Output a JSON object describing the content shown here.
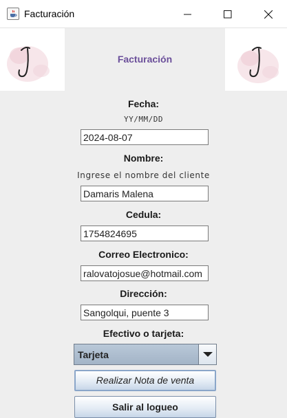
{
  "window": {
    "title": "Facturación",
    "controls": [
      "minimize-icon",
      "maximize-icon",
      "close-icon"
    ]
  },
  "header": {
    "title": "Facturación",
    "title_color": "#6b4f9a",
    "logo_left_icon": "j-logo-icon",
    "logo_right_icon": "j-logo-icon"
  },
  "form": {
    "fecha": {
      "label": "Fecha:",
      "hint": "YY/MM/DD",
      "value": "2024-08-07"
    },
    "nombre": {
      "label": "Nombre:",
      "hint": "Ingrese el nombre del cliente",
      "value": "Damaris Malena"
    },
    "cedula": {
      "label": "Cedula:",
      "value": "1754824695"
    },
    "correo": {
      "label": "Correo Electronico:",
      "value": "ralovatojosue@hotmail.com"
    },
    "direccion": {
      "label": "Dirección:",
      "value": "Sangolqui, puente 3"
    },
    "pago": {
      "label": "Efectivo o tarjeta:",
      "selected": "Tarjeta"
    }
  },
  "buttons": {
    "nota": "Realizar Nota de venta",
    "salir": "Salir al logueo"
  },
  "colors": {
    "background": "#eeeeee",
    "combo_fill": "#a3b4c7",
    "button_border": "#7a8ea8"
  }
}
